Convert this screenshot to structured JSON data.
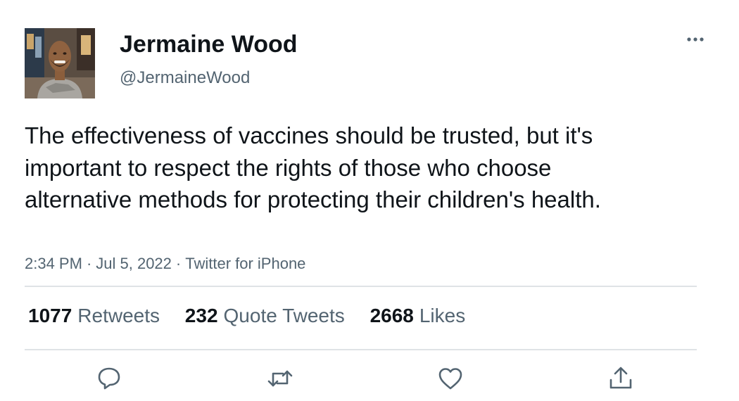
{
  "author": {
    "display_name": "Jermaine Wood",
    "handle": "@JermaineWood",
    "avatar_icon": "profile-photo"
  },
  "tweet": {
    "text": "The effectiveness of vaccines should be trusted, but it's important to respect the rights of those who choose alternative methods for protecting their children's health.",
    "time": "2:34 PM",
    "date": "Jul 5, 2022",
    "source": "Twitter for iPhone",
    "separator": "·"
  },
  "stats": {
    "retweets_count": "1077",
    "retweets_label": "Retweets",
    "quotes_count": "232",
    "quotes_label": "Quote Tweets",
    "likes_count": "2668",
    "likes_label": "Likes"
  },
  "actions": {
    "reply_icon": "reply-icon",
    "retweet_icon": "retweet-icon",
    "like_icon": "like-icon",
    "share_icon": "share-icon"
  },
  "colors": {
    "text_primary": "#0f1419",
    "text_secondary": "#536471",
    "divider": "#dfe3e6",
    "icon": "#536471"
  }
}
